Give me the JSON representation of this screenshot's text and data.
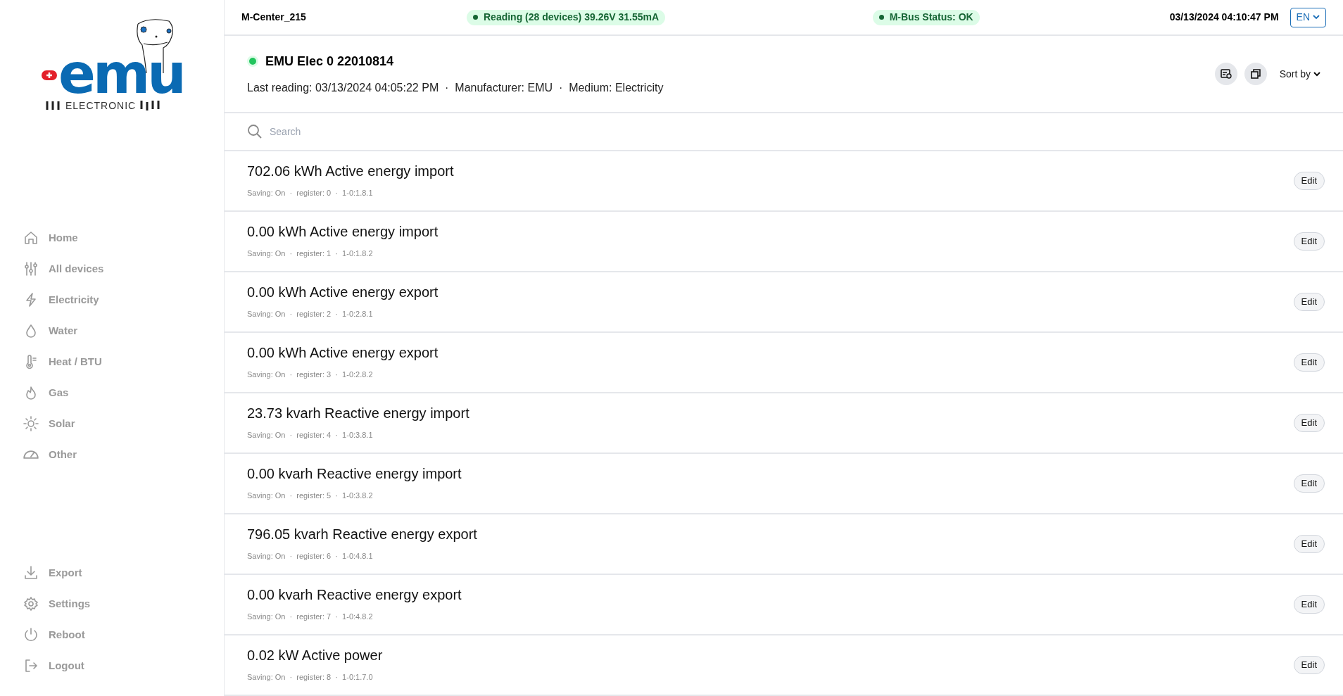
{
  "logo": {
    "wordmark": "emu",
    "tagline": "ELECTRONIC"
  },
  "sidebar": {
    "items": [
      {
        "kind": "home",
        "label": "Home"
      },
      {
        "kind": "sliders",
        "label": "All devices"
      },
      {
        "kind": "bolt",
        "label": "Electricity"
      },
      {
        "kind": "drop",
        "label": "Water"
      },
      {
        "kind": "thermo",
        "label": "Heat / BTU"
      },
      {
        "kind": "flame",
        "label": "Gas"
      },
      {
        "kind": "sun",
        "label": "Solar"
      },
      {
        "kind": "gauge",
        "label": "Other"
      }
    ],
    "bottom_items": [
      {
        "kind": "export",
        "label": "Export"
      },
      {
        "kind": "gear",
        "label": "Settings"
      },
      {
        "kind": "power",
        "label": "Reboot"
      },
      {
        "kind": "logout",
        "label": "Logout"
      }
    ]
  },
  "top_bar": {
    "device_name": "M-Center_215",
    "statuses": [
      {
        "text": "Reading (28 devices) 39.26V 31.55mA",
        "color": "#166534"
      },
      {
        "text": "M-Bus Status: OK",
        "color": "#166534"
      }
    ],
    "datetime": "03/13/2024 04:10:47 PM",
    "language": "EN"
  },
  "device": {
    "title": "EMU Elec 0 22010814",
    "online": true,
    "meta": "Last reading: 03/13/2024 04:05:22 PM  ·  Manufacturer: EMU  ·  Medium: Electricity",
    "sort_label": "Sort by"
  },
  "search": {
    "placeholder": "Search"
  },
  "registers": [
    {
      "title": "702.06 kWh Active energy import",
      "details": "Saving: On  ·  register: 0  ·  1-0:1.8.1",
      "button": "Edit"
    },
    {
      "title": "0.00 kWh Active energy import",
      "details": "Saving: On  ·  register: 1  ·  1-0:1.8.2",
      "button": "Edit"
    },
    {
      "title": "0.00 kWh Active energy export",
      "details": "Saving: On  ·  register: 2  ·  1-0:2.8.1",
      "button": "Edit"
    },
    {
      "title": "0.00 kWh Active energy export",
      "details": "Saving: On  ·  register: 3  ·  1-0:2.8.2",
      "button": "Edit"
    },
    {
      "title": "23.73 kvarh Reactive energy import",
      "details": "Saving: On  ·  register: 4  ·  1-0:3.8.1",
      "button": "Edit"
    },
    {
      "title": "0.00 kvarh Reactive energy import",
      "details": "Saving: On  ·  register: 5  ·  1-0:3.8.2",
      "button": "Edit"
    },
    {
      "title": "796.05 kvarh Reactive energy export",
      "details": "Saving: On  ·  register: 6  ·  1-0:4.8.1",
      "button": "Edit"
    },
    {
      "title": "0.00 kvarh Reactive energy export",
      "details": "Saving: On  ·  register: 7  ·  1-0:4.8.2",
      "button": "Edit"
    },
    {
      "title": "0.02 kW Active power",
      "details": "Saving: On  ·  register: 8  ·  1-0:1.7.0",
      "button": "Edit"
    }
  ]
}
